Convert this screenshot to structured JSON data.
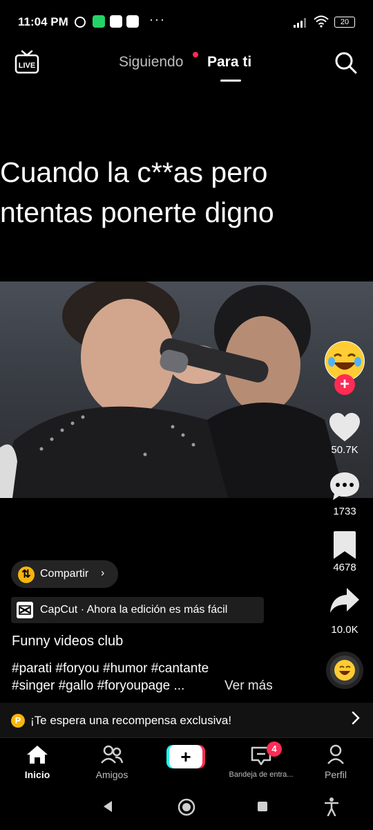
{
  "status_bar": {
    "time": "11:04 PM",
    "more": "···",
    "battery": "20"
  },
  "top_nav": {
    "live_label": "LIVE",
    "following": "Siguiendo",
    "for_you": "Para ti"
  },
  "caption": "Cuando la c**as pero\nntentas ponerte digno",
  "right_rail": {
    "likes": "50.7K",
    "comments": "1733",
    "saves": "4678",
    "shares": "10.0K"
  },
  "info": {
    "share_label": "Compartir",
    "share_chevron": "›",
    "capcut_label": "CapCut · Ahora la edición es más fácil",
    "author": "Funny videos club",
    "hashtags_line1": "#parati #foryou #humor #cantante",
    "hashtags_line2": "#singer #gallo #foryoupage ...",
    "see_more": "Ver más"
  },
  "reward": {
    "coin": "P",
    "text": "¡Te espera una recompensa exclusiva!"
  },
  "bottom_nav": {
    "home": "Inicio",
    "friends": "Amigos",
    "create": "+",
    "inbox": "Bandeja de entra...",
    "inbox_badge": "4",
    "profile": "Perfil"
  },
  "colors": {
    "accent": "#fe2c55",
    "cyan": "#25f4ee",
    "coin": "#f7b50c"
  }
}
